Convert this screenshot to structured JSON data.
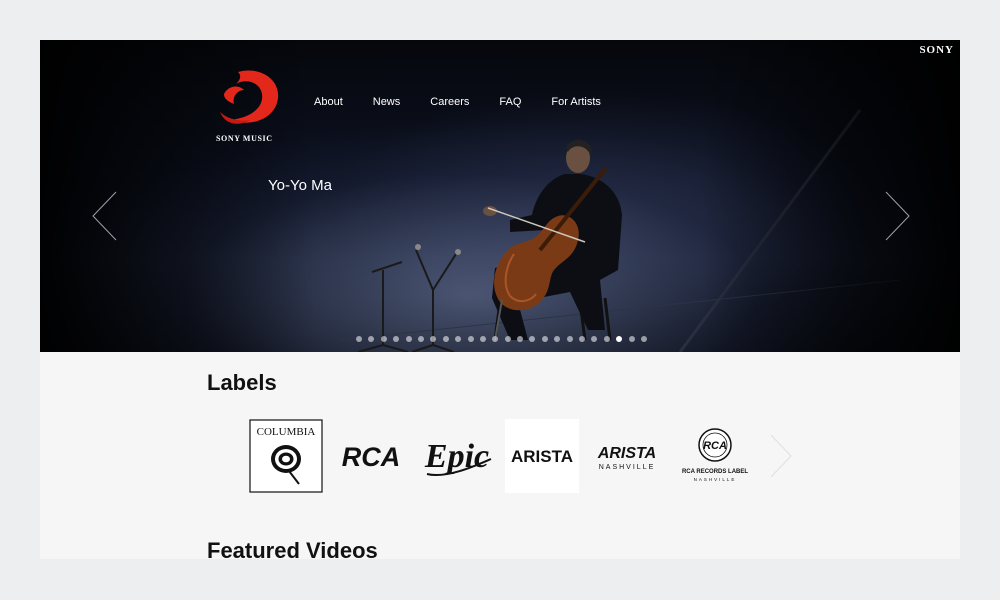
{
  "header": {
    "brand": "SONY",
    "logo_text": "SONY MUSIC",
    "nav": [
      "About",
      "News",
      "Careers",
      "FAQ",
      "For Artists"
    ]
  },
  "hero": {
    "artist": "Yo-Yo Ma",
    "slide_count": 24,
    "active_slide": 21
  },
  "labels": {
    "title": "Labels",
    "items": [
      {
        "name": "columbia-logo",
        "text": "COLUMBIA"
      },
      {
        "name": "rca-logo",
        "text": "RCA"
      },
      {
        "name": "epic-logo",
        "text": "Epic"
      },
      {
        "name": "arista-logo",
        "text": "ARISTA"
      },
      {
        "name": "arista-nashville-logo",
        "text": "ARISTA",
        "subtext": "NASHVILLE"
      },
      {
        "name": "rca-nashville-logo",
        "text": "RCA",
        "subtext": "RCA RECORDS LABEL",
        "subtext2": "NASHVILLE"
      }
    ]
  },
  "featured": {
    "title": "Featured Videos"
  },
  "colors": {
    "logo_red": "#e3281b",
    "hero_dark": "#0d1222",
    "body_bg": "#f6f6f6"
  },
  "icons": [
    "sony-music-logo",
    "chevron-left-icon",
    "chevron-right-icon"
  ]
}
